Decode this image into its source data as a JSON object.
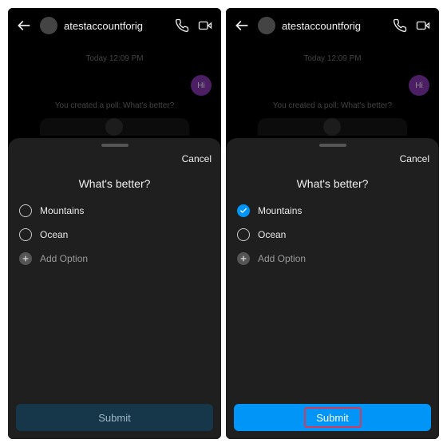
{
  "header": {
    "username": "atestaccountforig"
  },
  "chat": {
    "timestamp": "Today 12:09 PM",
    "hi_bubble": "Hi",
    "poll_created": "You created a poll: What's better?"
  },
  "sheet": {
    "cancel": "Cancel",
    "question": "What's better?",
    "options": [
      {
        "label": "Mountains"
      },
      {
        "label": "Ocean"
      }
    ],
    "add_option": "Add Option",
    "submit": "Submit"
  },
  "colors": {
    "accent": "#0095f6",
    "sheet_bg": "#1f1f1f",
    "submit_inactive_bg": "#16374a",
    "highlight": "#d63a5a",
    "bubble": "#8a3ab9"
  },
  "state": {
    "left_selected": null,
    "right_selected": "Mountains"
  }
}
